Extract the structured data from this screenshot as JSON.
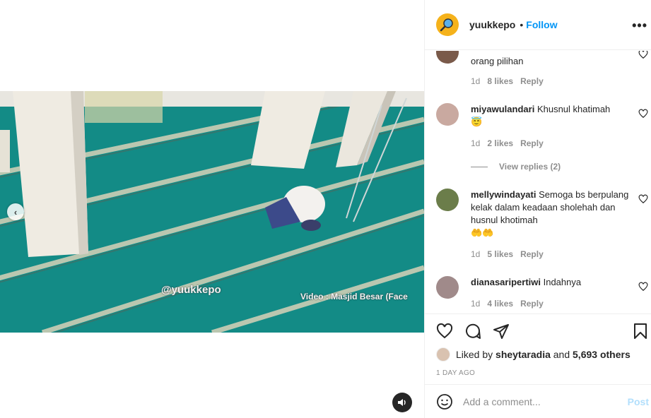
{
  "post": {
    "watermark": "@yuukkepo",
    "credit": "Video : Masjid Besar (Face"
  },
  "header": {
    "username": "yuukkepo",
    "dot": "•",
    "follow_label": "Follow",
    "more_label": "•••"
  },
  "comments": [
    {
      "username": "",
      "text": "orang pilihan",
      "age": "1d",
      "likes": "8 likes",
      "reply": "Reply",
      "avatar_color": "#7a5a4a"
    },
    {
      "username": "miyawulandari",
      "text": "Khusnul khatimah",
      "emoji": "😇",
      "age": "1d",
      "likes": "2 likes",
      "reply": "Reply",
      "avatar_color": "#c9a9a0",
      "view_replies": "View replies (2)"
    },
    {
      "username": "mellywindayati",
      "text": "Semoga bs berpulang kelak dalam keadaan sholehah dan husnul khotimah",
      "emoji": "🤲🤲",
      "age": "1d",
      "likes": "5 likes",
      "reply": "Reply",
      "avatar_color": "#6b7d4a"
    },
    {
      "username": "dianasaripertiwi",
      "text": "Indahnya",
      "age": "1d",
      "likes": "4 likes",
      "reply": "Reply",
      "avatar_color": "#a08a8a"
    }
  ],
  "likes": {
    "prefix": "Liked by",
    "user": "sheytaradia",
    "conj": "and",
    "others": "5,693 others"
  },
  "timestamp": "1 DAY AGO",
  "add_comment": {
    "placeholder": "Add a comment...",
    "post_label": "Post"
  },
  "colors": {
    "accent": "#0095f6",
    "carpet": "#1a8a85",
    "avatar_bg": "#f5b21b"
  }
}
